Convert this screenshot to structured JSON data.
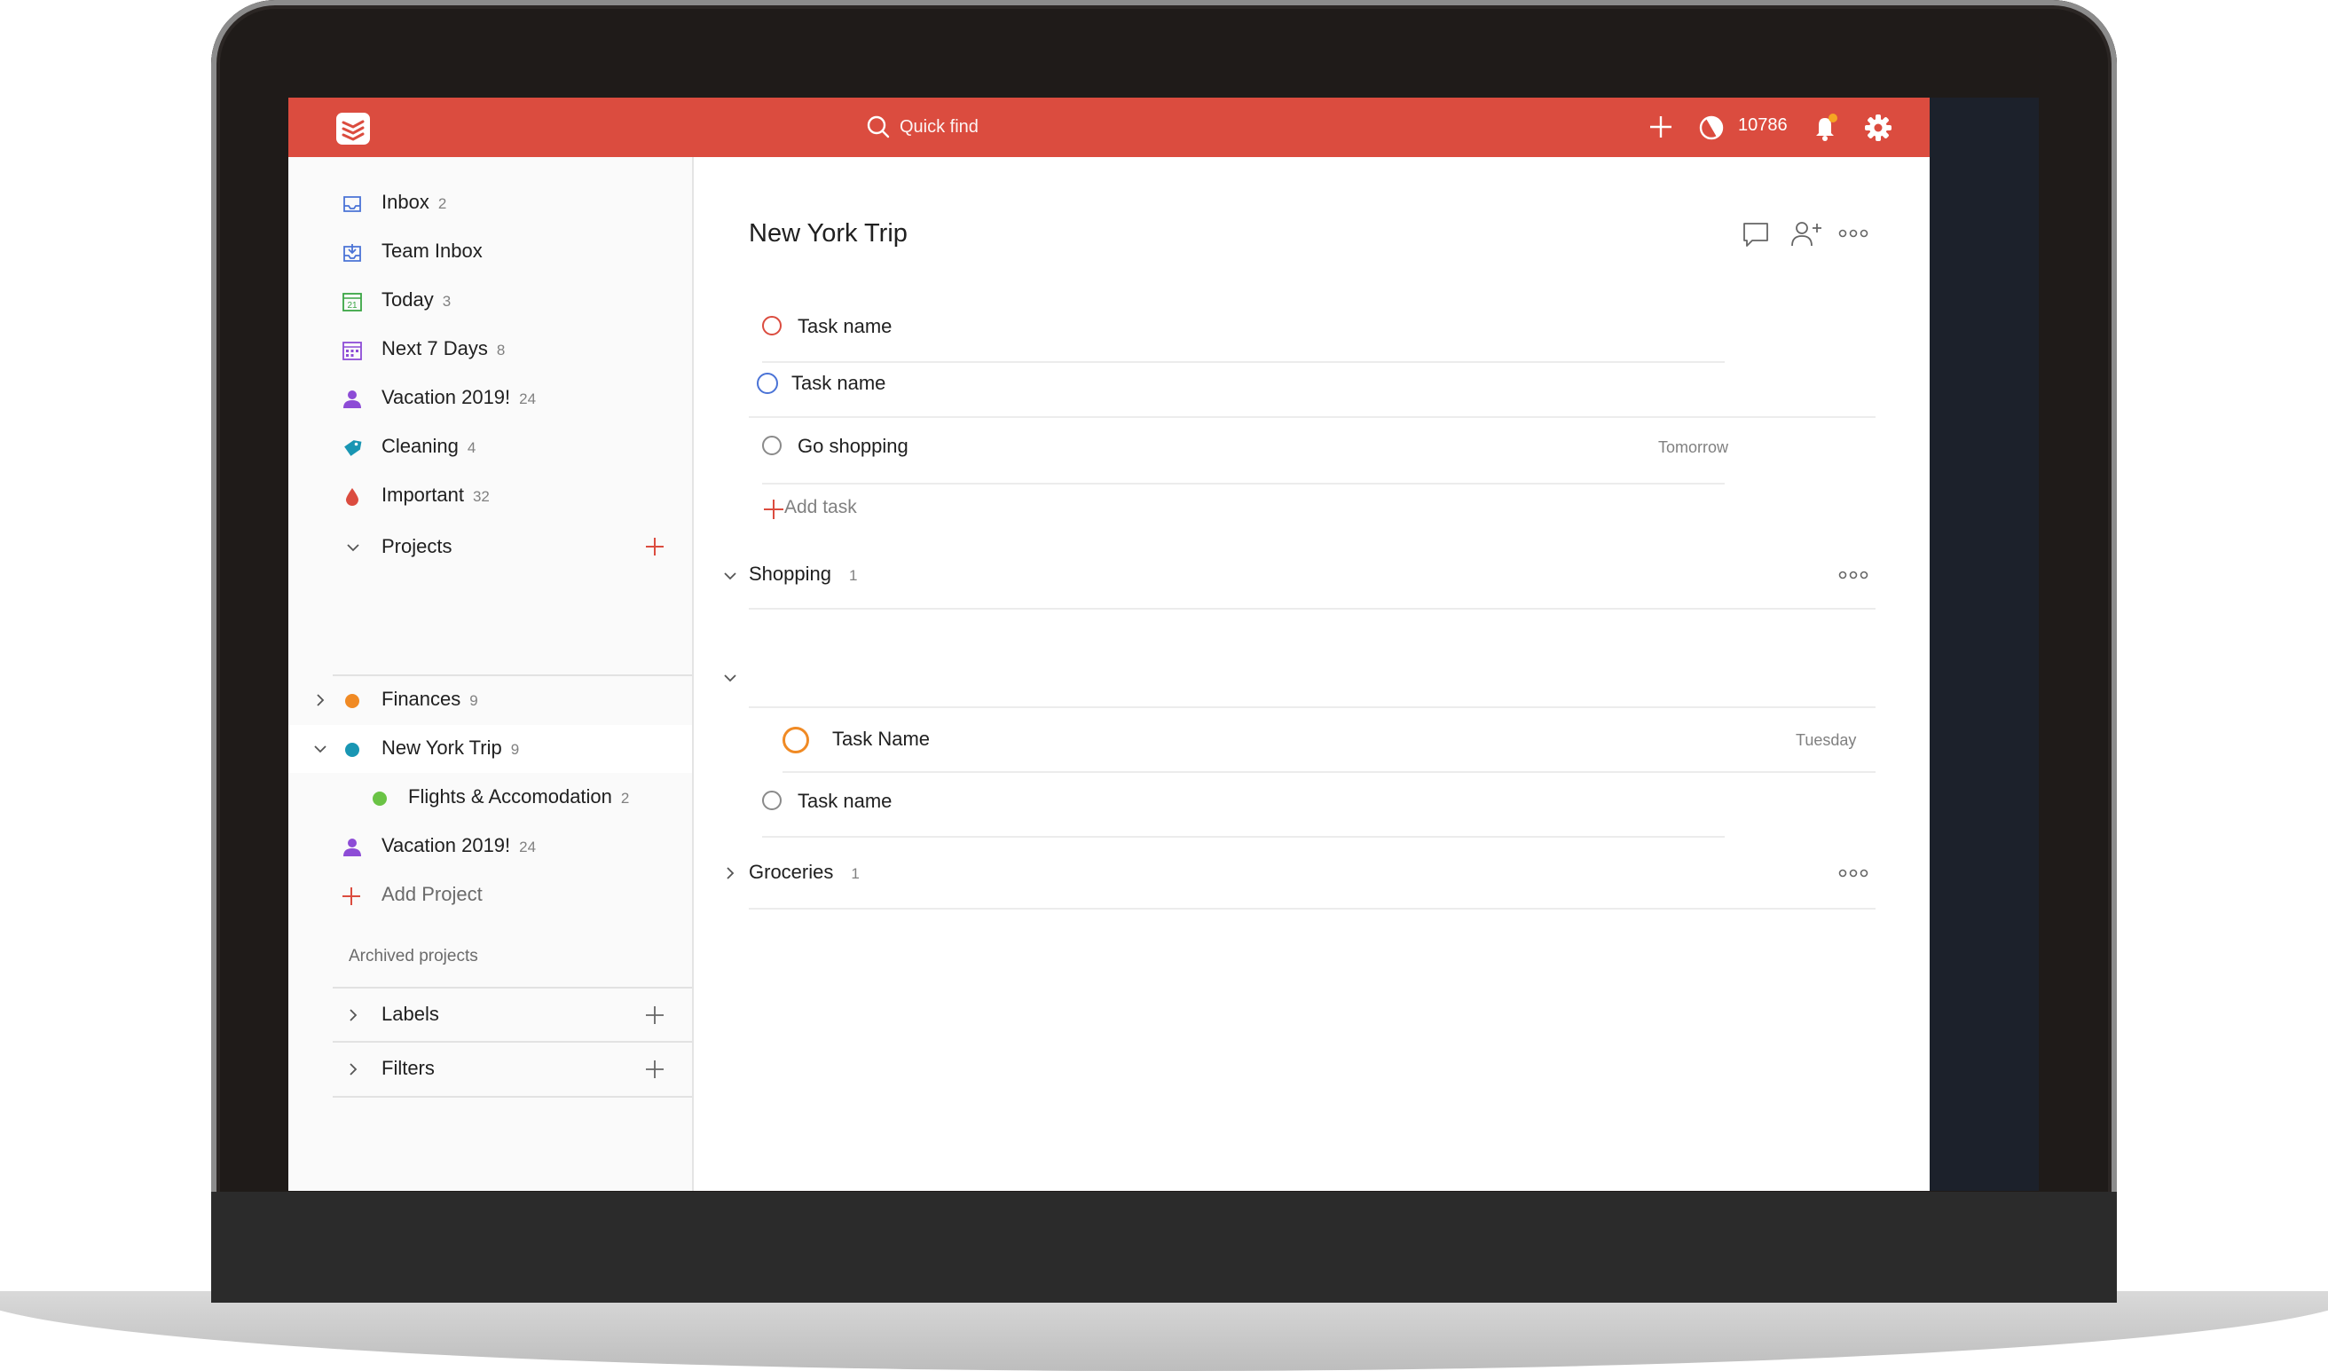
{
  "topbar": {
    "search_placeholder": "Quick find",
    "karma_points": "10786"
  },
  "sidebar": {
    "items": [
      {
        "label": "Inbox",
        "count": "2",
        "icon": "inbox-icon"
      },
      {
        "label": "Team Inbox",
        "count": "",
        "icon": "team-inbox-icon"
      },
      {
        "label": "Today",
        "count": "3",
        "icon": "calendar-today-icon"
      },
      {
        "label": "Next 7 Days",
        "count": "8",
        "icon": "calendar-week-icon"
      },
      {
        "label": "Vacation 2019!",
        "count": "24",
        "icon": "person-icon"
      },
      {
        "label": "Cleaning",
        "count": "4",
        "icon": "tag-icon"
      },
      {
        "label": "Important",
        "count": "32",
        "icon": "drop-icon"
      }
    ],
    "projects_header": "Projects",
    "projects": [
      {
        "label": "Finances",
        "count": "9",
        "color": "#f08a24"
      },
      {
        "label": "New York Trip",
        "count": "9",
        "color": "#1996b3"
      },
      {
        "label": "Flights & Accomodation",
        "count": "2",
        "color": "#6ac345"
      },
      {
        "label": "Vacation 2019!",
        "count": "24",
        "color": "#8d4cd6"
      }
    ],
    "add_project": "Add Project",
    "archived": "Archived projects",
    "labels": "Labels",
    "filters": "Filters"
  },
  "main": {
    "title": "New York Trip",
    "tasks": [
      {
        "name": "Task name",
        "due": "",
        "priority_color": "#db4c3f"
      },
      {
        "name": "Task name",
        "due": "",
        "priority_color": "#4a73d6"
      },
      {
        "name": "Go shopping",
        "due": "Tomorrow",
        "priority_color": "#8a8a8a"
      }
    ],
    "add_task": "Add task",
    "sections": [
      {
        "name": "Shopping",
        "count": "1"
      },
      {
        "name": "Groceries",
        "count": "1"
      }
    ],
    "section_tasks": [
      {
        "name": "Task Name",
        "due": "Tuesday",
        "priority_color": "#f08a24"
      },
      {
        "name": "Task name",
        "due": "",
        "priority_color": "#8a8a8a"
      }
    ]
  },
  "colors": {
    "brand": "#db4c3f",
    "sidebar_bg": "#fafafa",
    "accent_plus": "#db4c3f"
  }
}
